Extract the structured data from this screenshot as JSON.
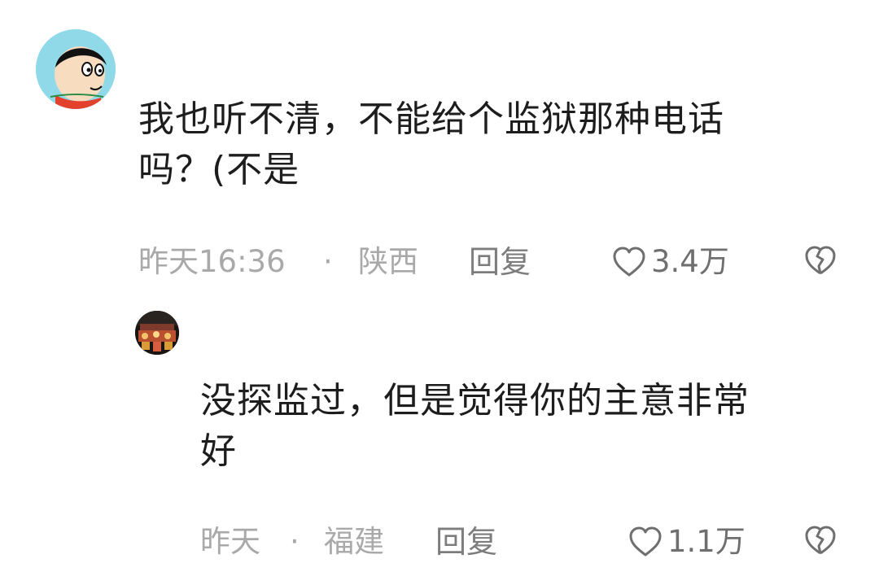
{
  "comments": [
    {
      "avatar_icon": "cartoon-avatar-icon",
      "text": "我也听不清，不能给个监狱那种电话\n吗？(不是",
      "time": "昨天16:36",
      "separator": "·",
      "location": "陕西",
      "reply_label": "回复",
      "likes": "3.4万",
      "like_icon": "heart-outline-icon",
      "dislike_icon": "broken-heart-icon"
    },
    {
      "avatar_icon": "photo-avatar-icon",
      "text": "没探监过，但是觉得你的主意非常\n好",
      "time": "昨天",
      "separator": "·",
      "location": "福建",
      "reply_label": "回复",
      "likes": "1.1万",
      "like_icon": "heart-outline-icon",
      "dislike_icon": "broken-heart-icon"
    }
  ],
  "colors": {
    "text": "#1d1d1d",
    "meta": "#a9a9a9",
    "reply": "#7d7d7d",
    "icon": "#6f6f6f",
    "background": "#ffffff"
  }
}
